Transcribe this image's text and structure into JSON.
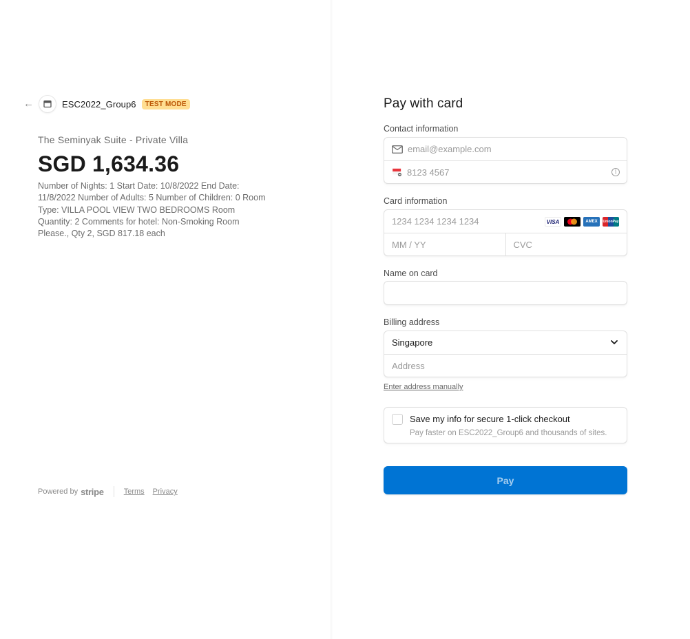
{
  "merchant": {
    "name": "ESC2022_Group6",
    "badge": "TEST MODE"
  },
  "summary": {
    "product_name": "The Seminyak Suite - Private Villa",
    "amount": "SGD 1,634.36",
    "description": "Number of Nights: 1 Start Date: 10/8/2022 End Date: 11/8/2022 Number of Adults: 5 Number of Children: 0 Room Type: VILLA POOL VIEW TWO BEDROOMS Room Quantity: 2 Comments for hotel: Non-Smoking Room Please., Qty 2, SGD 817.18 each"
  },
  "footer": {
    "powered_by": "Powered by",
    "brand": "stripe",
    "terms": "Terms",
    "privacy": "Privacy"
  },
  "form": {
    "title": "Pay with card",
    "contact": {
      "label": "Contact information",
      "email_placeholder": "email@example.com",
      "phone_placeholder": "8123 4567"
    },
    "card": {
      "label": "Card information",
      "number_placeholder": "1234 1234 1234 1234",
      "expiry_placeholder": "MM / YY",
      "cvc_placeholder": "CVC",
      "brands": [
        "VISA",
        "mastercard",
        "AMEX",
        "UnionPay"
      ]
    },
    "name": {
      "label": "Name on card",
      "value": ""
    },
    "billing": {
      "label": "Billing address",
      "country": "Singapore",
      "address_placeholder": "Address",
      "manual_link": "Enter address manually"
    },
    "save_info": {
      "title": "Save my info for secure 1-click checkout",
      "subtitle": "Pay faster on ESC2022_Group6 and thousands of sites.",
      "checked": false
    },
    "pay_button": "Pay"
  },
  "colors": {
    "pay_button": "#0074d4",
    "badge_bg": "#ffde92",
    "badge_text": "#bb5504"
  }
}
